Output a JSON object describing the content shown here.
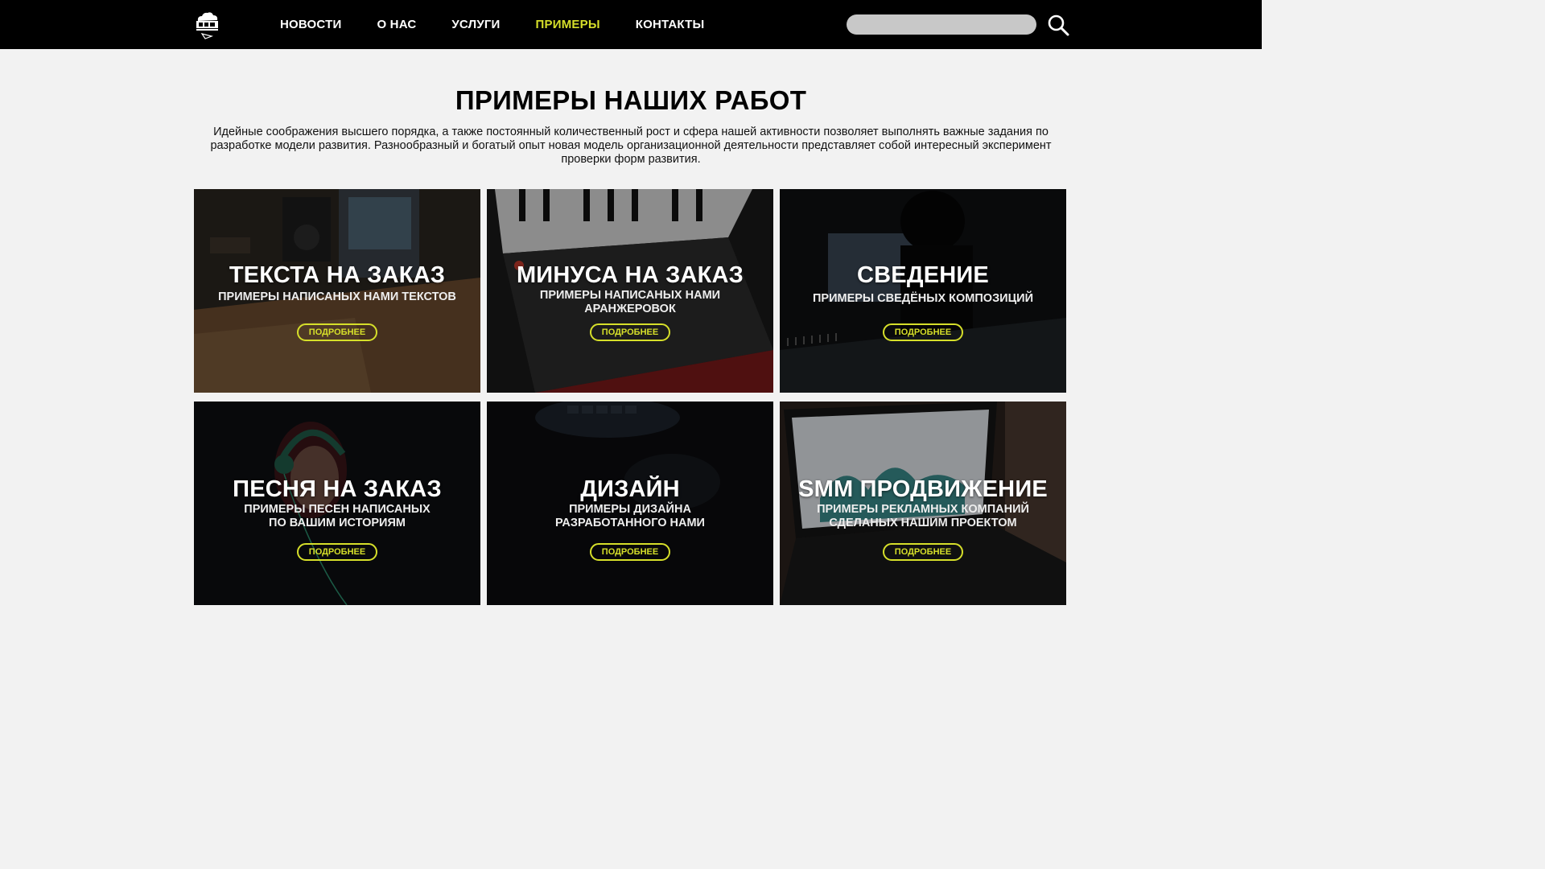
{
  "header": {
    "logo_icon": "logo-cloud-icon",
    "nav": [
      {
        "label": "НОВОСТИ",
        "active": false
      },
      {
        "label": "О НАС",
        "active": false
      },
      {
        "label": "УСЛУГИ",
        "active": false
      },
      {
        "label": "ПРИМЕРЫ",
        "active": true
      },
      {
        "label": "КОНТАКТЫ",
        "active": false
      }
    ],
    "search": {
      "value": "",
      "placeholder": "",
      "icon": "search-icon"
    },
    "active_color": "#d6df2a"
  },
  "main": {
    "title": "ПРИМЕРЫ НАШИХ РАБОТ",
    "intro": "Идейные соображения высшего порядка, а также постоянный количественный рост и сфера нашей активности позволяет выполнять важные задания по разработке модели развития. Разнообразный и богатый опыт новая модель организационной деятельности представляет собой интересный эксперимент проверки форм развития."
  },
  "cards": [
    {
      "title": "ТЕКСТА НА ЗАКАЗ",
      "subtitle": "ПРИМЕРЫ НАПИСАНЫХ НАМИ ТЕКСТОВ",
      "button": "ПОДРОБНЕЕ",
      "image": "studio-desk"
    },
    {
      "title": "МИНУСА НА ЗАКАЗ",
      "subtitle": "ПРИМЕРЫ НАПИСАНЫХ НАМИ АРАНЖЕРОВОК",
      "button": "ПОДРОБНЕЕ",
      "image": "midi-keyboard"
    },
    {
      "title": "СВЕДЕНИЕ",
      "subtitle": "ПРИМЕРЫ СВЕДЁНЫХ КОМПОЗИЦИЙ",
      "button": "ПОДРОБНЕЕ",
      "image": "mixing-console"
    },
    {
      "title": "ПЕСНЯ НА ЗАКАЗ",
      "subtitle": "ПРИМЕРЫ ПЕСЕН НАПИСАНЫХ ПО ВАШИМ ИСТОРИЯМ",
      "button": "ПОДРОБНЕЕ",
      "image": "headphones-singer"
    },
    {
      "title": "ДИЗАЙН",
      "subtitle": "ПРИМЕРЫ ДИЗАЙНА РАЗРАБОТАННОГО НАМИ",
      "button": "ПОДРОБНЕЕ",
      "image": "dark-keyboard-hand"
    },
    {
      "title": "SMM ПРОДВИЖЕНИЕ",
      "subtitle": "ПРИМЕРЫ РЕКЛАМНЫХ КОМПАНИЙ СДЕЛАНЫХ НАШИМ ПРОЕКТОМ",
      "button": "ПОДРОБНЕЕ",
      "image": "laptop-analytics"
    }
  ],
  "colors": {
    "header_bg": "#000000",
    "page_bg": "#f2f2f2",
    "accent": "#d6df2a"
  }
}
